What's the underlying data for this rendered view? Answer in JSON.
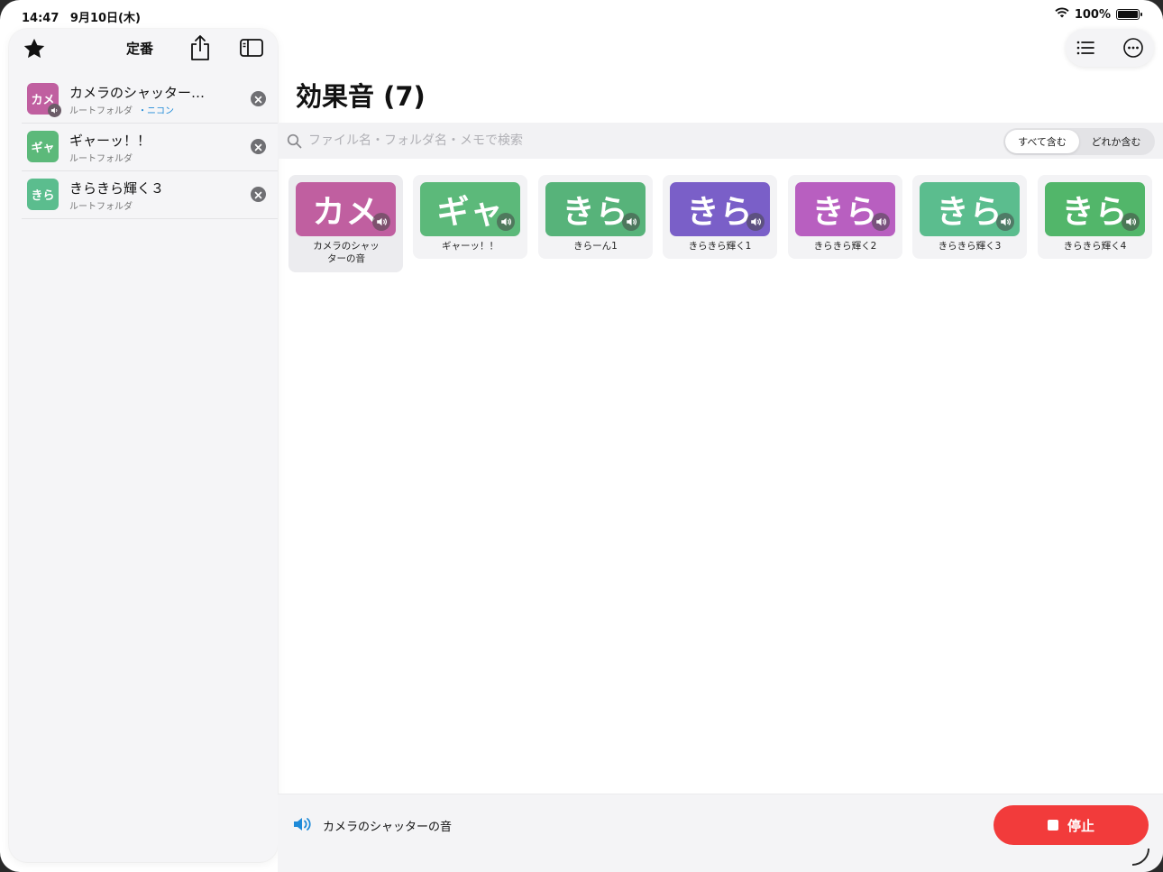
{
  "status_bar": {
    "time": "14:47",
    "date": "9月10日(木)",
    "battery": "100%"
  },
  "sidebar": {
    "title": "定番",
    "favorites": [
      {
        "thumb": "カメ",
        "name": "カメラのシャッター…",
        "folder": "ルートフォルダ",
        "tag": "・ニコン",
        "color": "#c05fa0",
        "has_speaker": true
      },
      {
        "thumb": "ギャ",
        "name": "ギャーッ！！",
        "folder": "ルートフォルダ",
        "tag": "",
        "color": "#5cb97a",
        "has_speaker": false
      },
      {
        "thumb": "きら",
        "name": "きらきら輝く３",
        "folder": "ルートフォルダ",
        "tag": "",
        "color": "#5bbd8e",
        "has_speaker": false
      }
    ]
  },
  "main": {
    "title": "効果音 (7)",
    "search": {
      "placeholder": "ファイル名・フォルダ名・メモで検索",
      "value": ""
    },
    "filter": {
      "options": [
        "すべて含む",
        "どれか含む"
      ],
      "selected": "すべて含む"
    },
    "sounds": [
      {
        "thumb": "カメ",
        "label": "カメラのシャッターの音",
        "color": "#c05fa0",
        "selected": true
      },
      {
        "thumb": "ギャ",
        "label": "ギャーッ！！",
        "color": "#5cb97a",
        "selected": false
      },
      {
        "thumb": "きら",
        "label": "きらーん1",
        "color": "#57b37a",
        "selected": false
      },
      {
        "thumb": "きら",
        "label": "きらきら輝く1",
        "color": "#7a5fc8",
        "selected": false
      },
      {
        "thumb": "きら",
        "label": "きらきら輝く2",
        "color": "#b85fc0",
        "selected": false
      },
      {
        "thumb": "きら",
        "label": "きらきら輝く3",
        "color": "#5bbd8e",
        "selected": false
      },
      {
        "thumb": "きら",
        "label": "きらきら輝く4",
        "color": "#52b66a",
        "selected": false
      }
    ]
  },
  "player": {
    "now_playing": "カメラのシャッターの音",
    "stop_label": "停止"
  },
  "colors": {
    "accent": "#1e8ad8",
    "stop": "#f23b3b"
  },
  "icons": [
    "star-icon",
    "share-icon",
    "sidebar-toggle-icon",
    "list-icon",
    "more-icon",
    "search-icon",
    "speaker-icon",
    "close-icon",
    "wifi-icon",
    "battery-icon"
  ]
}
